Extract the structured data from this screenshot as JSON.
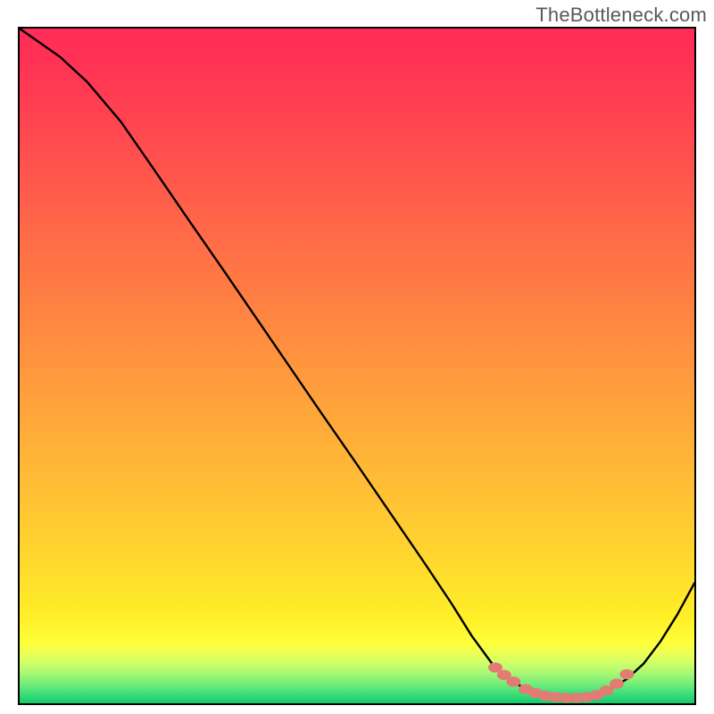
{
  "watermark": "TheBottleneck.com",
  "chart_data": {
    "type": "line",
    "title": "",
    "xlabel": "",
    "ylabel": "",
    "xlim": [
      0,
      100
    ],
    "ylim": [
      0,
      100
    ],
    "curve_points_percent": [
      [
        0.0,
        100.0
      ],
      [
        6.0,
        95.8
      ],
      [
        10.0,
        92.1
      ],
      [
        15.0,
        86.2
      ],
      [
        20.0,
        79.0
      ],
      [
        25.0,
        71.7
      ],
      [
        30.0,
        64.5
      ],
      [
        35.0,
        57.2
      ],
      [
        40.0,
        49.9
      ],
      [
        45.0,
        42.6
      ],
      [
        50.0,
        35.4
      ],
      [
        55.0,
        28.1
      ],
      [
        60.0,
        20.8
      ],
      [
        64.0,
        14.8
      ],
      [
        67.0,
        10.0
      ],
      [
        70.0,
        5.9
      ],
      [
        72.5,
        3.6
      ],
      [
        75.0,
        2.1
      ],
      [
        77.5,
        1.2
      ],
      [
        80.0,
        0.8
      ],
      [
        82.5,
        0.8
      ],
      [
        85.0,
        1.2
      ],
      [
        87.5,
        2.1
      ],
      [
        90.0,
        3.6
      ],
      [
        92.5,
        5.9
      ],
      [
        95.0,
        9.2
      ],
      [
        97.5,
        13.2
      ],
      [
        100.0,
        17.8
      ]
    ],
    "marker_points_percent": [
      [
        70.5,
        5.3
      ],
      [
        71.8,
        4.2
      ],
      [
        73.2,
        3.2
      ],
      [
        75.0,
        2.1
      ],
      [
        76.5,
        1.5
      ],
      [
        78.0,
        1.1
      ],
      [
        79.5,
        0.9
      ],
      [
        81.0,
        0.8
      ],
      [
        82.5,
        0.8
      ],
      [
        84.0,
        0.9
      ],
      [
        85.5,
        1.2
      ],
      [
        87.0,
        1.9
      ],
      [
        88.5,
        2.9
      ],
      [
        90.0,
        4.3
      ]
    ],
    "gradient_stops": [
      {
        "offset": 0.0,
        "color": "#ff2c57"
      },
      {
        "offset": 0.06,
        "color": "#ff3454"
      },
      {
        "offset": 0.14,
        "color": "#ff4550"
      },
      {
        "offset": 0.22,
        "color": "#ff574c"
      },
      {
        "offset": 0.3,
        "color": "#ff6948"
      },
      {
        "offset": 0.38,
        "color": "#ff7b44"
      },
      {
        "offset": 0.46,
        "color": "#ff8d40"
      },
      {
        "offset": 0.54,
        "color": "#ff9f3c"
      },
      {
        "offset": 0.62,
        "color": "#ffb138"
      },
      {
        "offset": 0.7,
        "color": "#ffc334"
      },
      {
        "offset": 0.76,
        "color": "#ffd130"
      },
      {
        "offset": 0.82,
        "color": "#ffe02c"
      },
      {
        "offset": 0.875,
        "color": "#fff028"
      },
      {
        "offset": 0.91,
        "color": "#feff3a"
      },
      {
        "offset": 0.925,
        "color": "#eeff55"
      },
      {
        "offset": 0.94,
        "color": "#d0ff68"
      },
      {
        "offset": 0.955,
        "color": "#a8f874"
      },
      {
        "offset": 0.97,
        "color": "#78ee78"
      },
      {
        "offset": 0.985,
        "color": "#40df7a"
      },
      {
        "offset": 1.0,
        "color": "#14c96c"
      }
    ]
  }
}
